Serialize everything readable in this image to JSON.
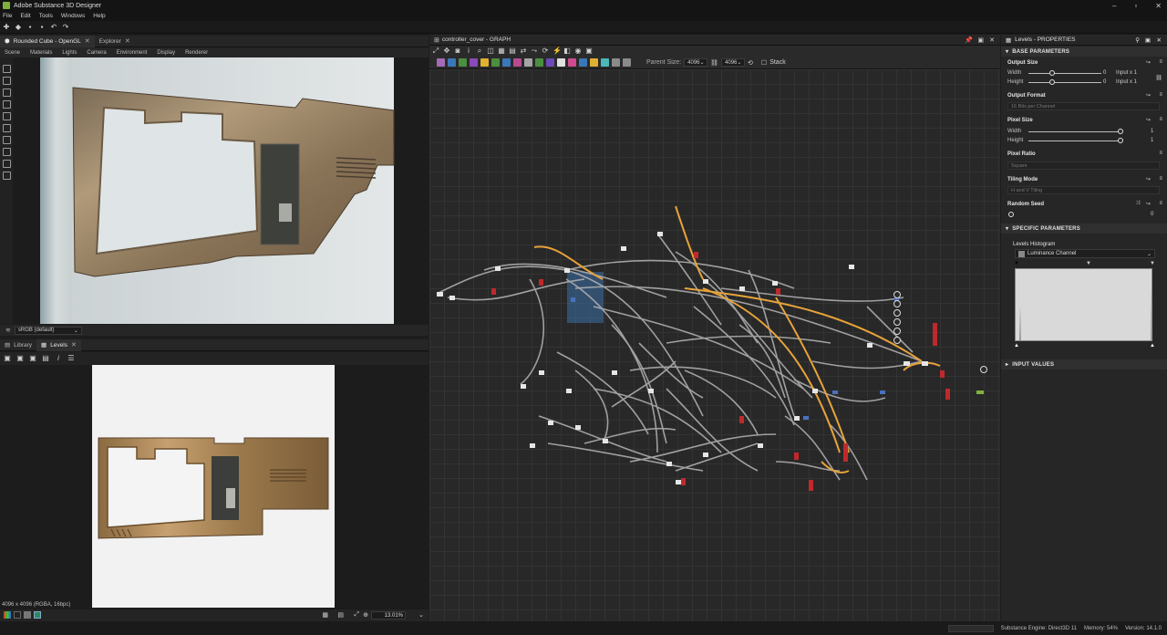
{
  "app": {
    "title": "Adobe Substance 3D Designer"
  },
  "menu": [
    "File",
    "Edit",
    "Tools",
    "Windows",
    "Help"
  ],
  "viewport3d": {
    "tabs": [
      {
        "label": "Rounded Cube - OpenGL"
      },
      {
        "label": "Explorer"
      }
    ],
    "submenu": [
      "Scene",
      "Materials",
      "Lights",
      "Camera",
      "Environment",
      "Display",
      "Renderer"
    ],
    "colorspace": "sRGB (default)"
  },
  "viewport2d": {
    "tabs": [
      {
        "label": "Library"
      },
      {
        "label": "Levels"
      }
    ],
    "status": "4096 x 4096 (RGBA, 16bpc)",
    "zoom": "13.01%"
  },
  "graph": {
    "title": "controller_cover - GRAPH",
    "parent_size_label": "Parent Size:",
    "parent_size_value": "4096",
    "size_value": "4096",
    "stack_label": "Stack"
  },
  "properties": {
    "title": "Levels - PROPERTIES",
    "base_section": "BASE PARAMETERS",
    "output_size": {
      "label": "Output Size",
      "width_label": "Width",
      "height_label": "Height",
      "width_value": "0",
      "height_value": "0",
      "width_suffix": "Input x 1",
      "height_suffix": "Input x 1"
    },
    "output_format": {
      "label": "Output Format",
      "value": "16 Bits per Channel"
    },
    "pixel_size": {
      "label": "Pixel Size",
      "width_label": "Width",
      "height_label": "Height",
      "width_value": "1",
      "height_value": "1"
    },
    "pixel_ratio": {
      "label": "Pixel Ratio",
      "value": "Square"
    },
    "tiling_mode": {
      "label": "Tiling Mode",
      "value": "H and V Tiling"
    },
    "random_seed": {
      "label": "Random Seed",
      "value": "0"
    },
    "specific_section": "SPECIFIC PARAMETERS",
    "levels_histogram": {
      "label": "Levels Histogram",
      "channel": "Luminance Channel"
    },
    "input_values_section": "INPUT VALUES"
  },
  "status": {
    "engine": "Substance Engine: Direct3D 11",
    "memory": "Memory: 54%",
    "version": "Version: 14.1.0"
  }
}
